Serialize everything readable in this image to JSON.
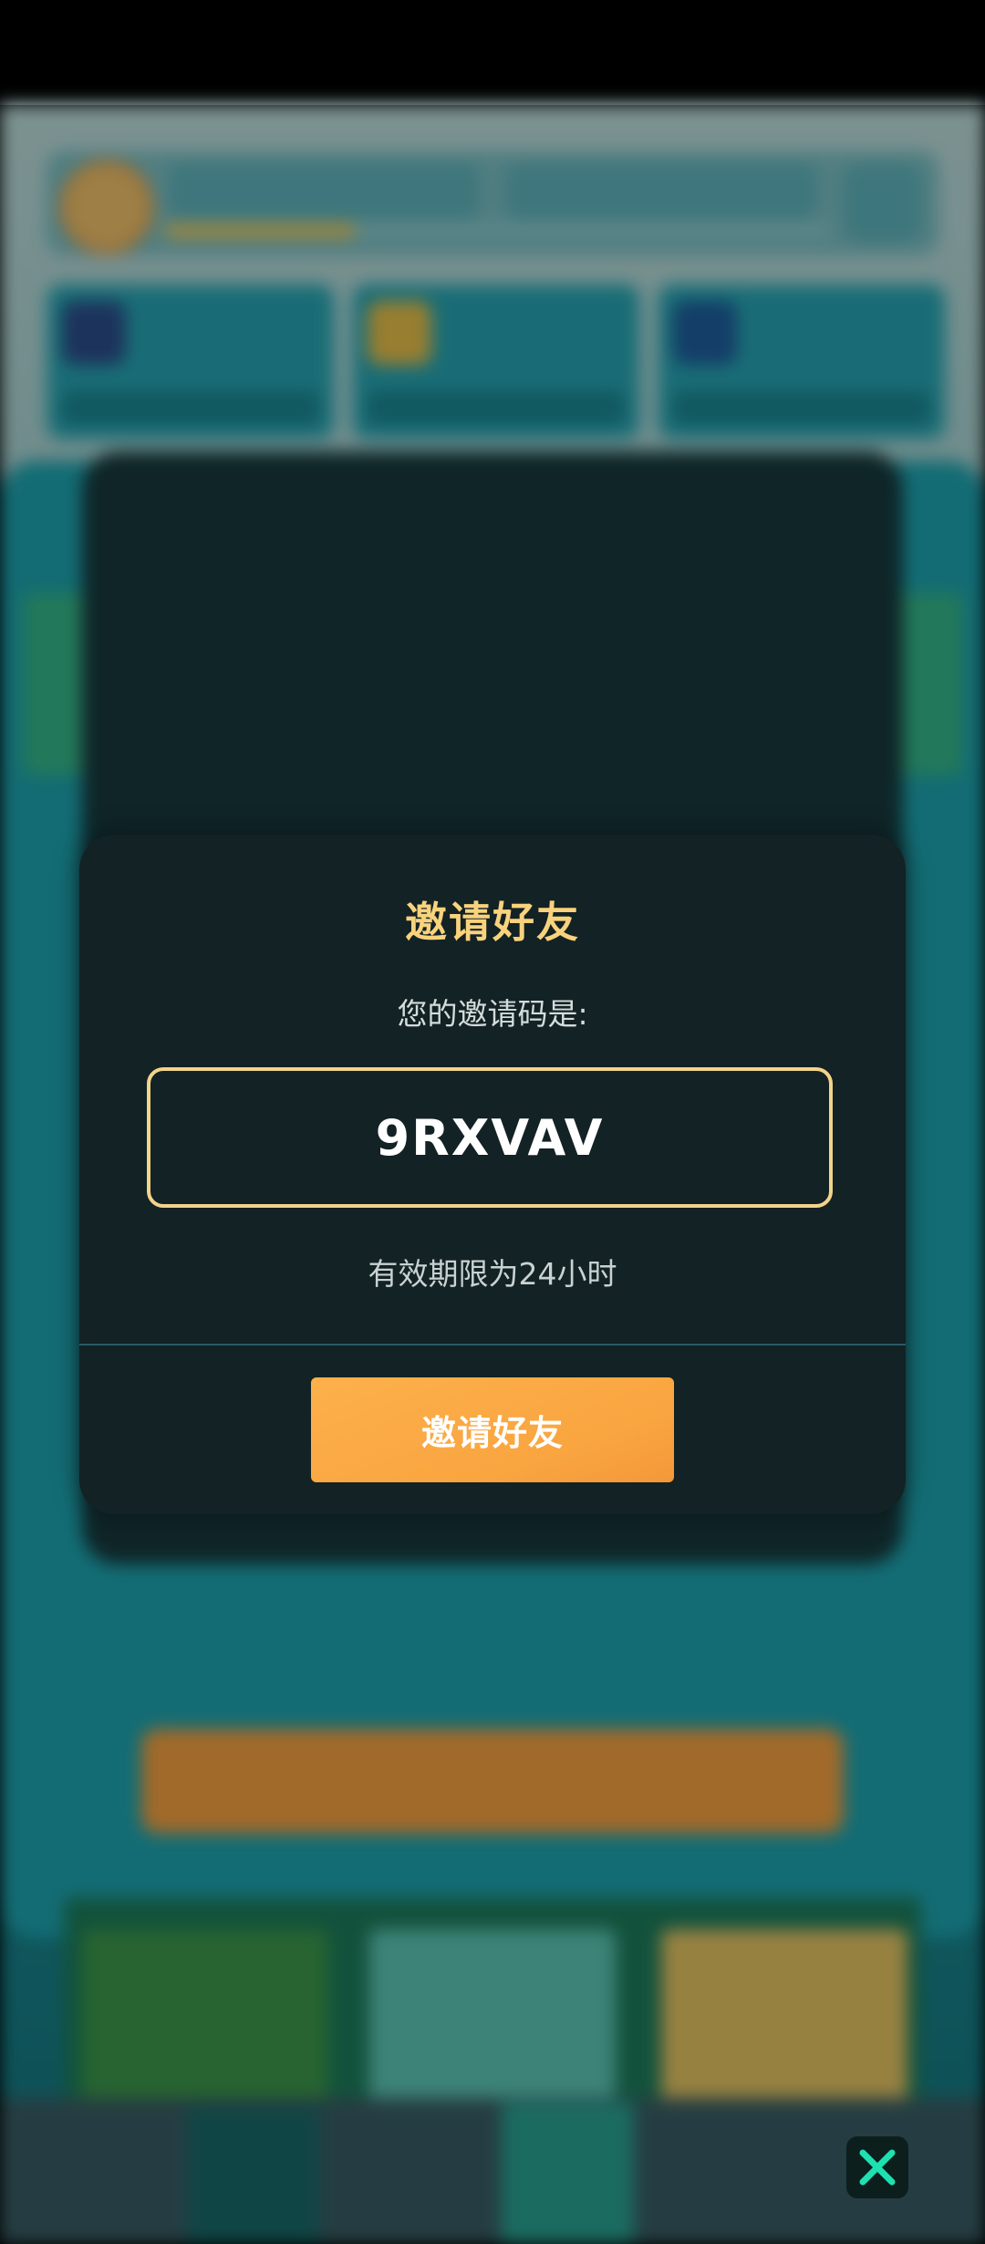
{
  "modal": {
    "title": "邀请好友",
    "code_label": "您的邀请码是:",
    "invite_code": "9RXVAV",
    "validity": "有效期限为24小时",
    "button_label": "邀请好友"
  },
  "icons": {
    "close": "close-icon"
  },
  "colors": {
    "modal_bg": "#132224",
    "title": "#f8d27d",
    "code_border": "#f2d48a",
    "button": "#f9a540",
    "close_x": "#1fe0b0"
  }
}
